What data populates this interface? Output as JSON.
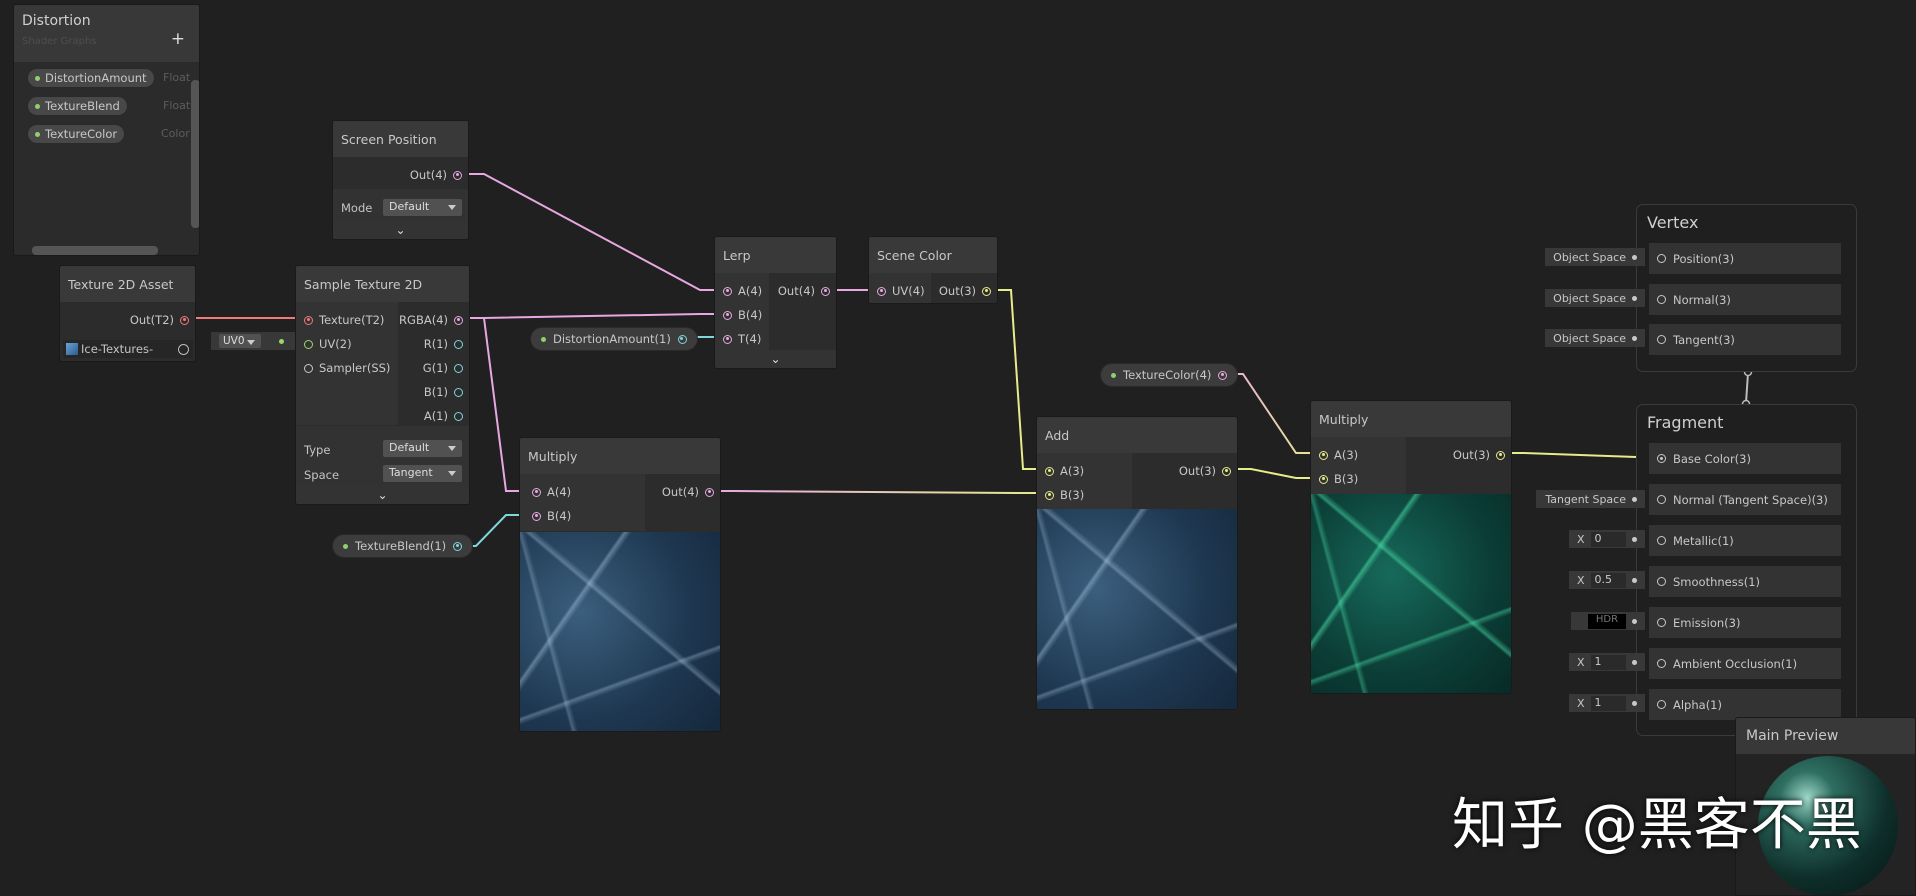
{
  "blackboard": {
    "title": "Distortion",
    "subtitle": "Shader Graphs",
    "add": "+",
    "properties": [
      {
        "name": "DistortionAmount",
        "type": "Float"
      },
      {
        "name": "TextureBlend",
        "type": "Float"
      },
      {
        "name": "TextureColor",
        "type": "Color"
      }
    ]
  },
  "nodes": {
    "screen_position": {
      "title": "Screen Position",
      "out": "Out(4)",
      "mode_label": "Mode",
      "mode_value": "Default"
    },
    "texture_asset": {
      "title": "Texture 2D Asset",
      "out": "Out(T2)",
      "texture": "Ice-Textures-"
    },
    "uv_input": "UV0",
    "sample_texture": {
      "title": "Sample Texture 2D",
      "inputs": [
        "Texture(T2)",
        "UV(2)",
        "Sampler(SS)"
      ],
      "outputs": [
        "RGBA(4)",
        "R(1)",
        "G(1)",
        "B(1)",
        "A(1)"
      ],
      "type_label": "Type",
      "type_value": "Default",
      "space_label": "Space",
      "space_value": "Tangent"
    },
    "lerp": {
      "title": "Lerp",
      "inputs": [
        "A(4)",
        "B(4)",
        "T(4)"
      ],
      "out": "Out(4)"
    },
    "scene_color": {
      "title": "Scene Color",
      "input": "UV(4)",
      "out": "Out(3)"
    },
    "multiply1": {
      "title": "Multiply",
      "inputs": [
        "A(4)",
        "B(4)"
      ],
      "out": "Out(4)"
    },
    "add": {
      "title": "Add",
      "inputs": [
        "A(3)",
        "B(3)"
      ],
      "out": "Out(3)"
    },
    "multiply2": {
      "title": "Multiply",
      "inputs": [
        "A(3)",
        "B(3)"
      ],
      "out": "Out(3)"
    }
  },
  "pills": {
    "distortion": "DistortionAmount(1)",
    "blend": "TextureBlend(1)",
    "color": "TextureColor(4)"
  },
  "vertex": {
    "title": "Vertex",
    "blocks": [
      {
        "label": "Position(3)",
        "input": "Object Space"
      },
      {
        "label": "Normal(3)",
        "input": "Object Space"
      },
      {
        "label": "Tangent(3)",
        "input": "Object Space"
      }
    ]
  },
  "fragment": {
    "title": "Fragment",
    "blocks": [
      {
        "label": "Base Color(3)"
      },
      {
        "label": "Normal (Tangent Space)(3)",
        "input": "Tangent Space"
      },
      {
        "label": "Metallic(1)",
        "x": "X",
        "value": "0"
      },
      {
        "label": "Smoothness(1)",
        "x": "X",
        "value": "0.5"
      },
      {
        "label": "Emission(3)",
        "value": "HDR"
      },
      {
        "label": "Ambient Occlusion(1)",
        "x": "X",
        "value": "1"
      },
      {
        "label": "Alpha(1)",
        "x": "X",
        "value": "1"
      }
    ]
  },
  "main_preview": {
    "title": "Main Preview"
  },
  "watermark": "知乎 @黑客不黑",
  "colors": {
    "vector4": "#e7a7e0",
    "texture": "#f07a7a",
    "float": "#7fd6de",
    "vector3": "#e6ec8a",
    "vector2": "#9bd86c"
  }
}
